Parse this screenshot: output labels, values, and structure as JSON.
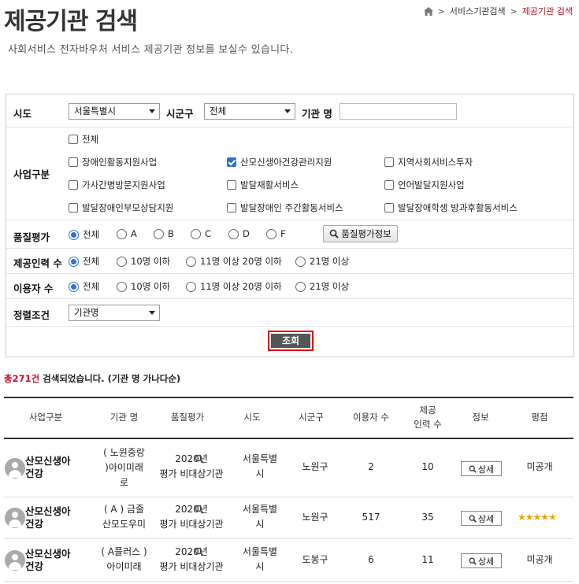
{
  "header": {
    "title": "제공기관 검색",
    "subtitle": "사회서비스 전자바우처 서비스 제공기관 정보를 보실수 있습니다.",
    "breadcrumb": {
      "home_icon": "home-icon",
      "parent": "서비스기관검색",
      "current": "제공기관 검색",
      "sep": ">"
    }
  },
  "form": {
    "sido_label": "시도",
    "sido_value": "서울특별시",
    "sigungu_label": "시군구",
    "sigungu_value": "전체",
    "org_label": "기관 명",
    "org_value": "",
    "biz_label": "사업구분",
    "biz_options": [
      {
        "label": "전체",
        "checked": false
      },
      {
        "label": "장애인활동지원사업",
        "checked": false
      },
      {
        "label": "산모신생아건강관리지원",
        "checked": true
      },
      {
        "label": "지역사회서비스투자",
        "checked": false
      },
      {
        "label": "가사간병방문지원사업",
        "checked": false
      },
      {
        "label": "발달재활서비스",
        "checked": false
      },
      {
        "label": "언어발달지원사업",
        "checked": false
      },
      {
        "label": "발달장애인부모상담지원",
        "checked": false
      },
      {
        "label": "발달장애인 주간활동서비스",
        "checked": false
      },
      {
        "label": "발달장애학생 방과후활동서비스",
        "checked": false
      }
    ],
    "quality_label": "품질평가",
    "quality_options": [
      "전체",
      "A",
      "B",
      "C",
      "D",
      "F"
    ],
    "quality_selected": "전체",
    "quality_button": "품질평가정보",
    "staff_label": "제공인력 수",
    "staff_options": [
      "전체",
      "10명 이하",
      "11명 이상 20명 이하",
      "21명 이상"
    ],
    "user_label": "이용자 수",
    "user_options": [
      "전체",
      "10명 이하",
      "11명 이상 20명 이하",
      "21명 이상"
    ],
    "sort_label": "정렬조건",
    "sort_value": "기관명",
    "search_button": "조회"
  },
  "result": {
    "count": "총271건",
    "text": " 검색되었습니다. (기관 명 가나다순)"
  },
  "table": {
    "headers": [
      "사업구분",
      "기관 명",
      "품질평가",
      "시도",
      "시군구",
      "이용자 수",
      "제공\n인력 수",
      "정보",
      "평점"
    ],
    "rows": [
      {
        "biz": "산모신생아\n건강",
        "org": "( 노원중랑\n)아이미래\n로",
        "quality": "2020년\n평가 비대상기관",
        "sido": "서울특별\n시",
        "sigungu": "노원구",
        "users": "2",
        "staff": "10",
        "info": "상세",
        "rating": "미공개",
        "stars": 0
      },
      {
        "biz": "산모신생아\n건강",
        "org": "( A ) 금줄\n산모도우미",
        "quality": "2020년\n평가 비대상기관",
        "sido": "서울특별\n시",
        "sigungu": "노원구",
        "users": "517",
        "staff": "35",
        "info": "상세",
        "rating": "",
        "stars": 5
      },
      {
        "biz": "산모신생아\n건강",
        "org": "( A플러스 )\n아이미래",
        "quality": "2020년\n평가 비대상기관",
        "sido": "서울특별\n시",
        "sigungu": "도봉구",
        "users": "6",
        "staff": "11",
        "info": "상세",
        "rating": "미공개",
        "stars": 0
      }
    ]
  }
}
